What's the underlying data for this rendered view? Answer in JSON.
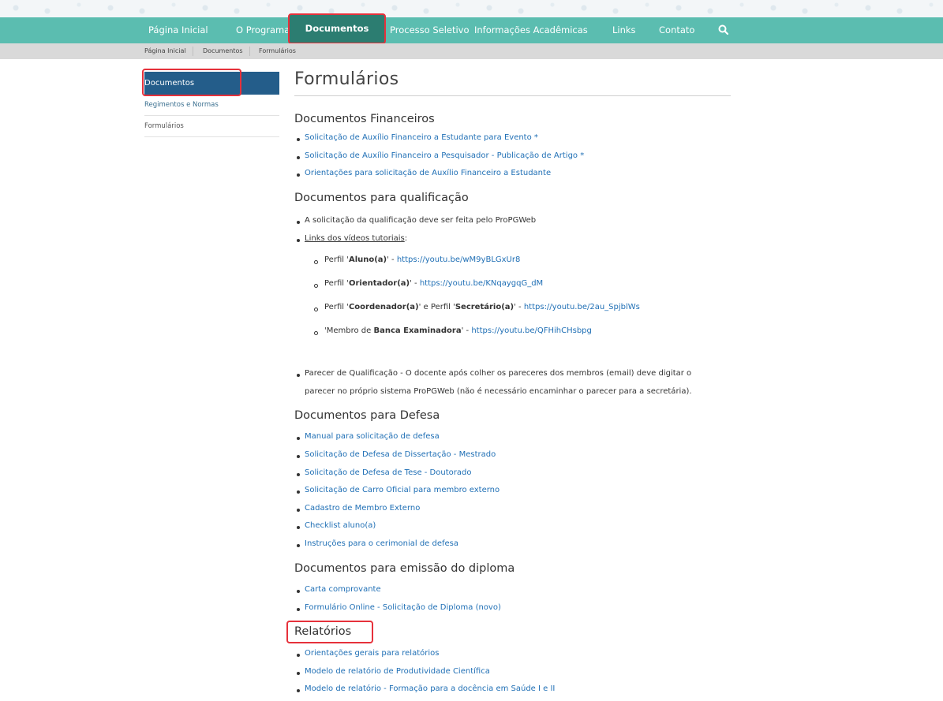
{
  "nav": {
    "items": [
      "Página Inicial",
      "O Programa",
      "Documentos",
      "Processo Seletivo",
      "Informações Acadêmicas",
      "Links",
      "Contato"
    ],
    "active": "Documentos"
  },
  "breadcrumb": [
    "Página Inicial",
    "Documentos",
    "Formulários"
  ],
  "sidebar": {
    "items": [
      "Documentos",
      "Regimentos e Normas",
      "Formulários"
    ]
  },
  "page": {
    "title": "Formulários",
    "sections": {
      "financeiros": {
        "heading": "Documentos Financeiros",
        "items": [
          "Solicitação de Auxílio Financeiro a Estudante para Evento *",
          "Solicitação de Auxílio Financeiro a Pesquisador - Publicação de Artigo *",
          "Orientações para solicitação de Auxílio Financeiro a Estudante"
        ]
      },
      "qualificacao": {
        "heading": "Documentos para qualificação",
        "item1": "A solicitação da qualificação deve ser feita pelo ProPGWeb",
        "item2": "Links dos vídeos tutoriais",
        "item2_colon": ":",
        "videos": [
          {
            "pre": "Perfil '",
            "role": "Aluno(a)",
            "post": "' - ",
            "url": "https://youtu.be/wM9yBLGxUr8"
          },
          {
            "pre": "Perfil '",
            "role": "Orientador(a)",
            "post": "' - ",
            "url": "https://youtu.be/KNqaygqG_dM"
          },
          {
            "pre": "Perfil '",
            "role": "Coordenador(a)",
            "mid": "' e Perfil '",
            "role2": "Secretário(a)",
            "post": "'  - ",
            "url": "https://youtu.be/2au_SpjblWs"
          },
          {
            "pre": "'Membro de ",
            "role": "Banca Examinadora",
            "post": "' - ",
            "url": "https://youtu.be/QFHihCHsbpg"
          }
        ],
        "parecer_line1": "Parecer de Qualificação - O docente após colher os pareceres dos membros (email) deve digitar o",
        "parecer_line2": "parecer no próprio sistema ProPGWeb (não é necessário encaminhar o parecer para a secretária)."
      },
      "defesa": {
        "heading": "Documentos para Defesa",
        "items": [
          "Manual para solicitação de defesa",
          "Solicitação de Defesa de Dissertação - Mestrado",
          "Solicitação de Defesa de Tese - Doutorado",
          "Solicitação de Carro Oficial para membro externo",
          "Cadastro de Membro Externo",
          "Checklist aluno(a)",
          "Instruções para o cerimonial de defesa"
        ]
      },
      "diploma": {
        "heading": "Documentos para emissão do diploma",
        "items": [
          "Carta comprovante",
          "Formulário Online - Solicitação de Diploma (novo)"
        ]
      },
      "relatorios": {
        "heading": "Relatórios",
        "items": [
          "Orientações gerais para relatórios",
          "Modelo de relatório de Produtividade Científica",
          "Modelo de relatório - Formação para a docência em Saúde I e II"
        ]
      }
    }
  },
  "colors": {
    "nav": "#5bbdb0",
    "nav_active": "#2c7d71",
    "sidebar_active": "#245d8a",
    "link": "#1f6fb5",
    "highlight": "#e6313b"
  }
}
